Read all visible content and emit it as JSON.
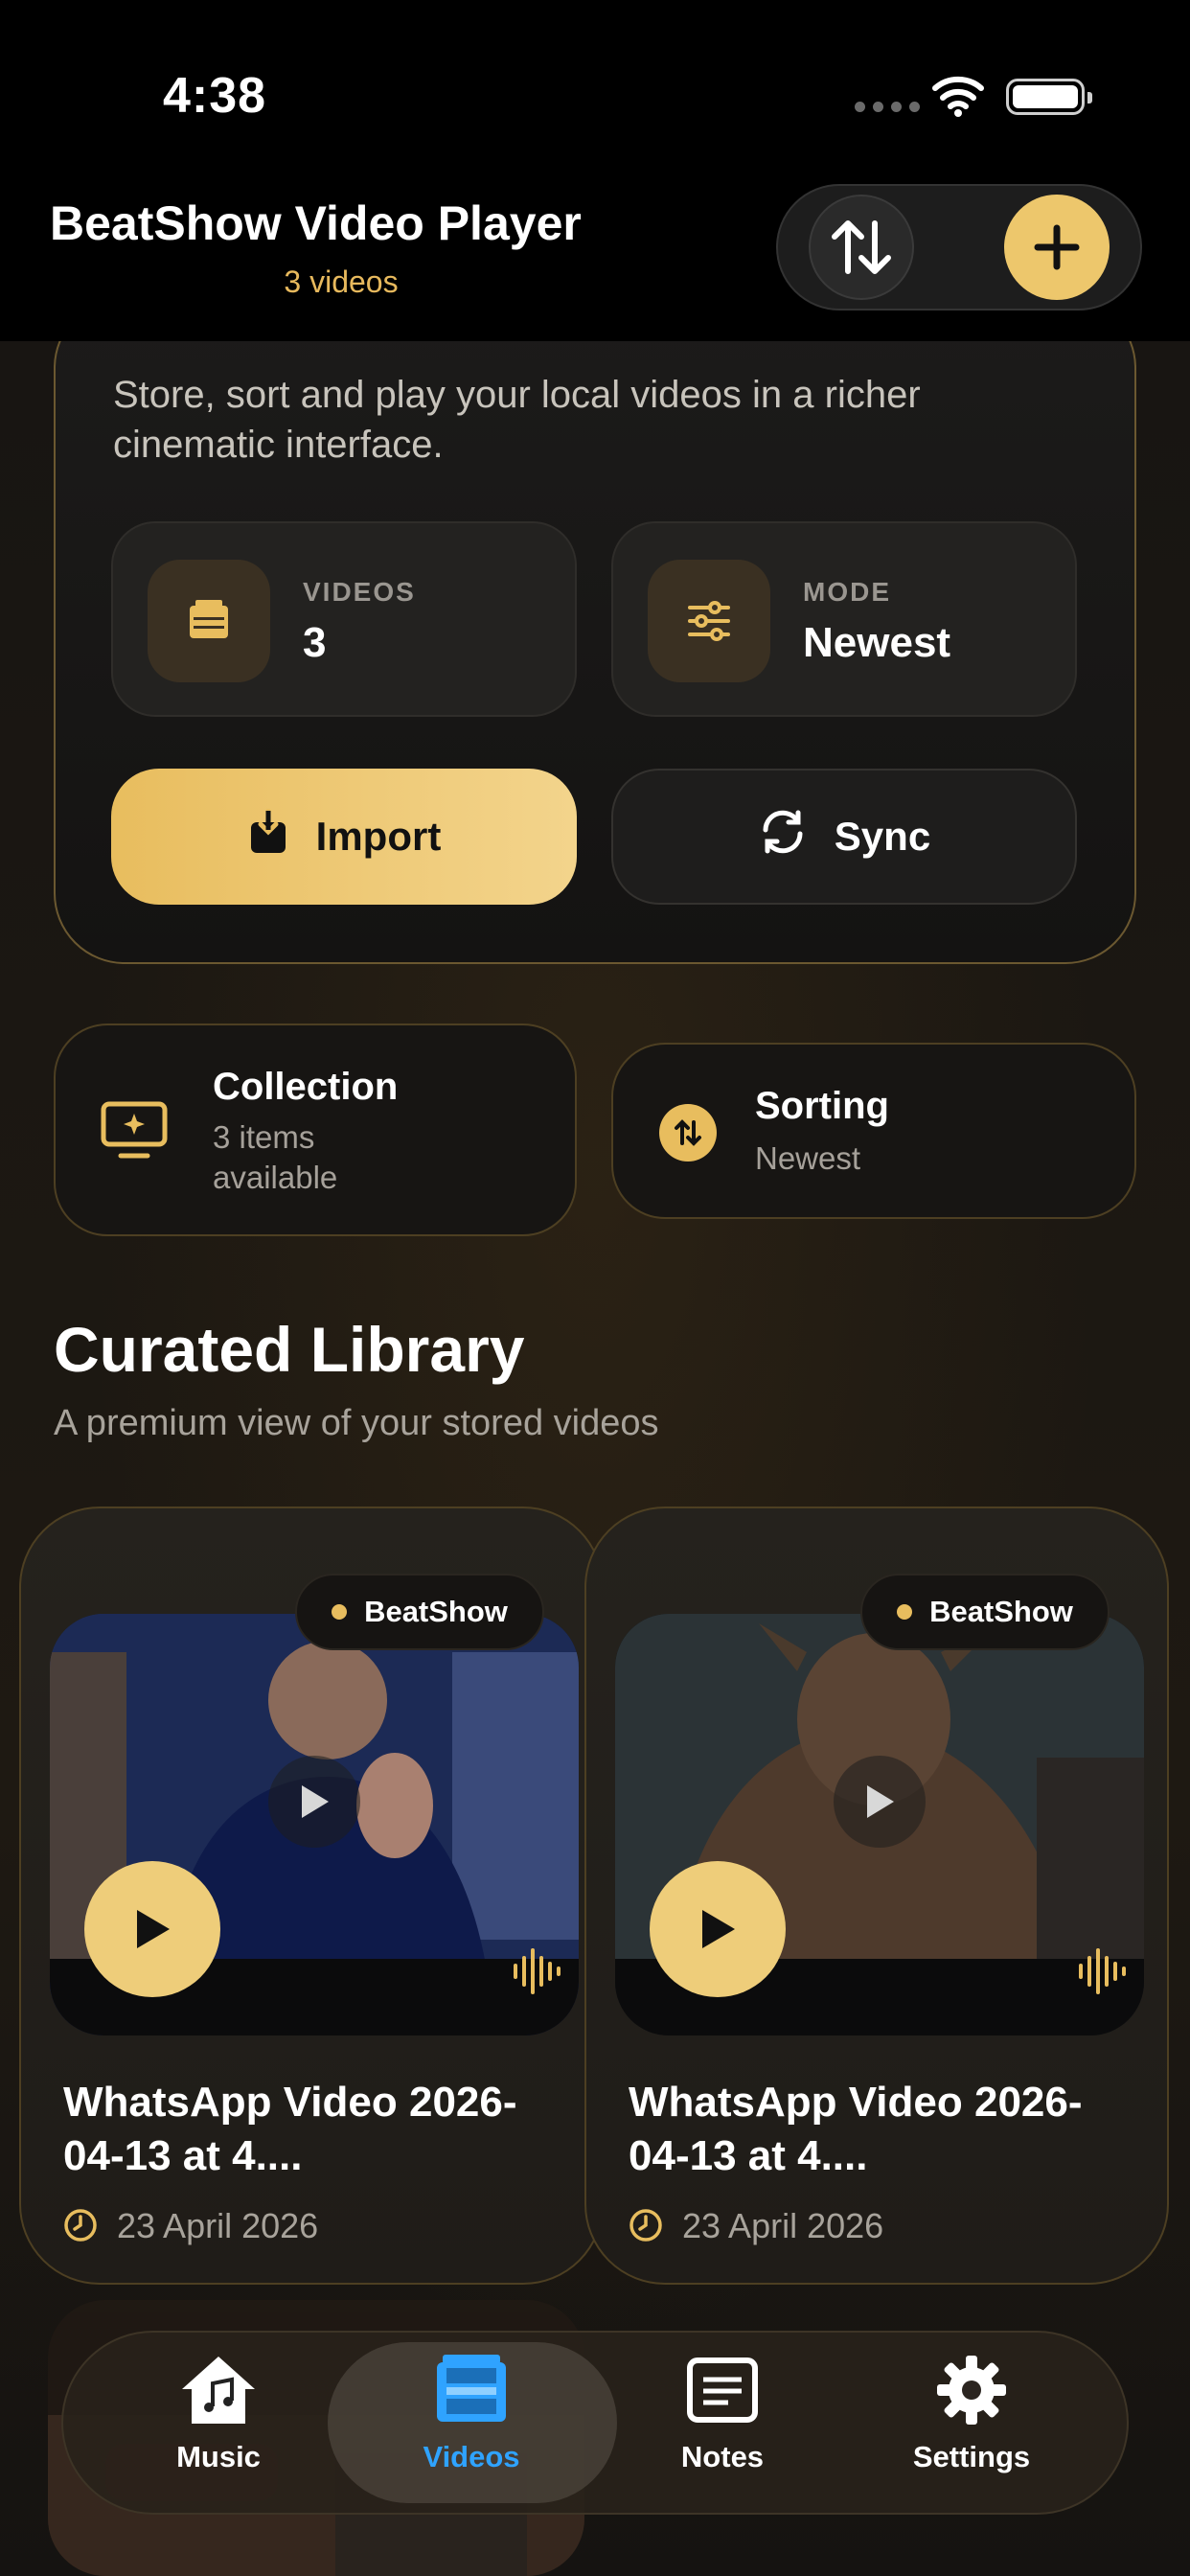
{
  "status_bar": {
    "time": "4:38"
  },
  "header": {
    "title": "BeatShow Video Player",
    "subtitle": "3 videos",
    "sort_icon": "arrows-up-down-icon",
    "add_icon": "plus-icon"
  },
  "hero": {
    "description": "Store, sort and play your local videos in a richer cinematic interface.",
    "stats": [
      {
        "label": "VIDEOS",
        "value": "3",
        "icon": "film-box-icon"
      },
      {
        "label": "MODE",
        "value": "Newest",
        "icon": "sliders-icon"
      }
    ],
    "import_label": "Import",
    "sync_label": "Sync"
  },
  "chips": {
    "collection": {
      "title": "Collection",
      "subtitle": "3 items available",
      "icon": "tv-sparkle-icon"
    },
    "sorting": {
      "title": "Sorting",
      "subtitle": "Newest",
      "icon": "sort-arrows-icon"
    }
  },
  "library": {
    "title": "Curated Library",
    "subtitle": "A premium view of your stored videos",
    "videos": [
      {
        "badge": "BeatShow",
        "title": "WhatsApp Video 2026-04-13 at 4....",
        "date": "23 April 2026"
      },
      {
        "badge": "BeatShow",
        "title": "WhatsApp Video 2026-04-13 at 4....",
        "date": "23 April 2026"
      }
    ]
  },
  "tabbar": {
    "tabs": [
      {
        "label": "Music",
        "icon": "home-music-icon"
      },
      {
        "label": "Videos",
        "icon": "film-icon",
        "active": true
      },
      {
        "label": "Notes",
        "icon": "notes-icon"
      },
      {
        "label": "Settings",
        "icon": "gear-icon"
      }
    ]
  },
  "colors": {
    "accent": "#E8BD5E",
    "active_tab": "#2FA3FF",
    "background": "#141210"
  }
}
